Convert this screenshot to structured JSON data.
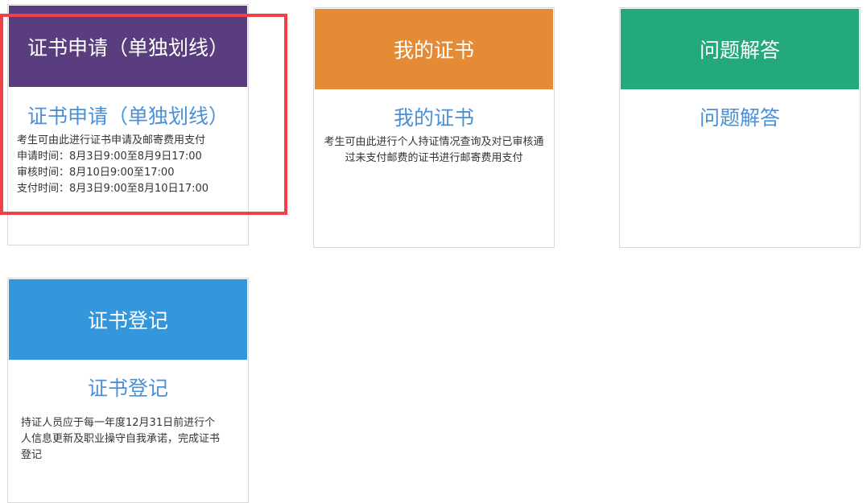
{
  "colors": {
    "card1_header": "#5a3d7e",
    "card2_header": "#e58a35",
    "card3_header": "#24a87d",
    "card4_header": "#3496db",
    "title_text": "#4a90d6",
    "highlight": "#f04048"
  },
  "cards": [
    {
      "header": "证书申请（单独划线）",
      "title": "证书申请（单独划线）",
      "lines": [
        "考生可由此进行证书申请及邮寄费用支付",
        "申请时间：8月3日9:00至8月9日17:00",
        "审核时间：8月10日9:00至17:00",
        "支付时间：8月3日9:00至8月10日17:00"
      ]
    },
    {
      "header": "我的证书",
      "title": "我的证书",
      "lines": [
        "考生可由此进行个人持证情况查询及对已审核通",
        "过未支付邮费的证书进行邮寄费用支付"
      ]
    },
    {
      "header": "问题解答",
      "title": "问题解答",
      "lines": []
    },
    {
      "header": "证书登记",
      "title": "证书登记",
      "lines": [
        "持证人员应于每一年度12月31日前进行个",
        "人信息更新及职业操守自我承诺，完成证书",
        "登记"
      ]
    }
  ]
}
